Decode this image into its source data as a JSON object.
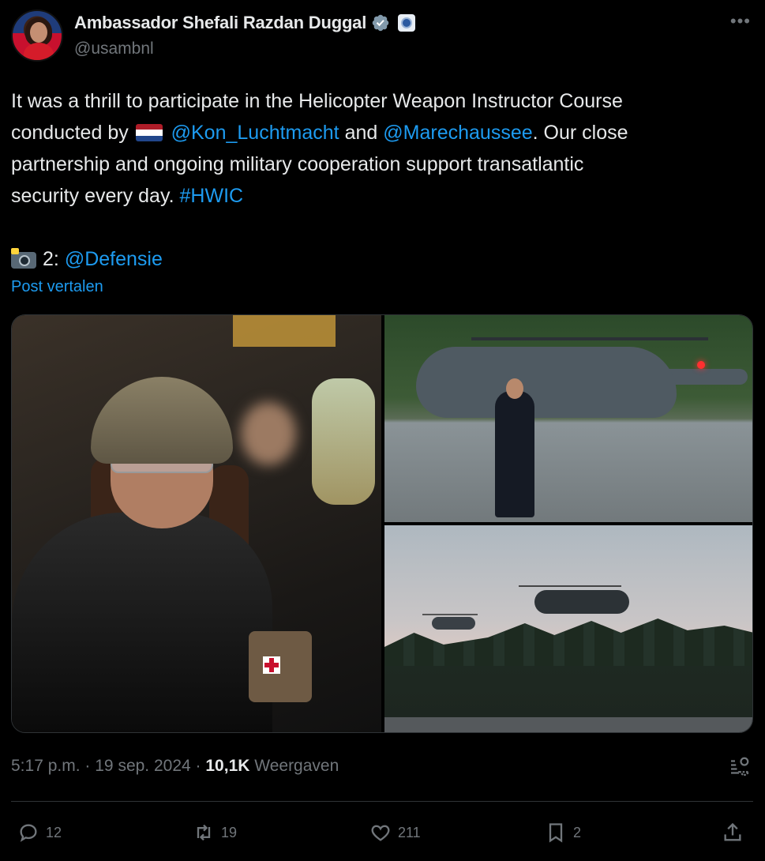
{
  "author": {
    "name": "Ambassador Shefali Razdan Duggal",
    "handle": "@usambnl"
  },
  "post": {
    "line1": "It was a thrill to participate in the Helicopter Weapon Instructor Course",
    "conducted_by": "conducted by",
    "mention1": "@Kon_Luchtmacht",
    "and": "and",
    "mention2": "@Marechaussee",
    "after_mention2": ". Our close",
    "line3": "partnership and ongoing military cooperation support transatlantic",
    "line4": "security every day.",
    "hashtag": "#HWIC",
    "photo_prefix": "2:",
    "photo_mention": "@Defensie",
    "translate": "Post vertalen"
  },
  "meta": {
    "time": "5:17 p.m.",
    "sep": "·",
    "date": "19 sep. 2024",
    "views_count": "10,1K",
    "views_label": "Weergaven"
  },
  "actions": {
    "replies": "12",
    "reposts": "19",
    "likes": "211",
    "bookmarks": "2"
  },
  "colors": {
    "accent": "#1d9bf0",
    "muted": "#71767b",
    "text": "#e7e9ea",
    "background": "#000000"
  }
}
